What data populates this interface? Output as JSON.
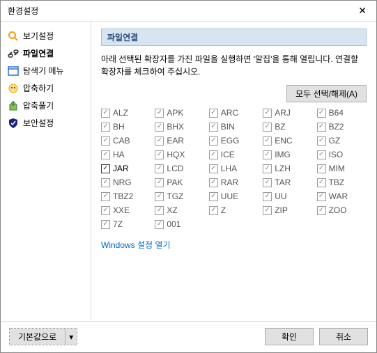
{
  "window": {
    "title": "환경설정",
    "close_glyph": "✕"
  },
  "sidebar": {
    "items": [
      {
        "label": "보기설정"
      },
      {
        "label": "파일연결"
      },
      {
        "label": "탐색기 메뉴"
      },
      {
        "label": "압축하기"
      },
      {
        "label": "압축풀기"
      },
      {
        "label": "보안설정"
      }
    ],
    "active_index": 1
  },
  "main": {
    "section_title": "파일연결",
    "description": "아래 선택된 확장자를 가진 파일을 실행하면 '알집'을 통해 열립니다. 연결할 확장자를 체크하여 주십시오.",
    "select_all_label": "모두 선택/해제(A)",
    "extensions": [
      {
        "name": "ALZ",
        "checked": true,
        "enabled": false
      },
      {
        "name": "APK",
        "checked": true,
        "enabled": false
      },
      {
        "name": "ARC",
        "checked": true,
        "enabled": false
      },
      {
        "name": "ARJ",
        "checked": true,
        "enabled": false
      },
      {
        "name": "B64",
        "checked": true,
        "enabled": false
      },
      {
        "name": "BH",
        "checked": true,
        "enabled": false
      },
      {
        "name": "BHX",
        "checked": true,
        "enabled": false
      },
      {
        "name": "BIN",
        "checked": true,
        "enabled": false
      },
      {
        "name": "BZ",
        "checked": true,
        "enabled": false
      },
      {
        "name": "BZ2",
        "checked": true,
        "enabled": false
      },
      {
        "name": "CAB",
        "checked": true,
        "enabled": false
      },
      {
        "name": "EAR",
        "checked": true,
        "enabled": false
      },
      {
        "name": "EGG",
        "checked": true,
        "enabled": false
      },
      {
        "name": "ENC",
        "checked": true,
        "enabled": false
      },
      {
        "name": "GZ",
        "checked": true,
        "enabled": false
      },
      {
        "name": "HA",
        "checked": true,
        "enabled": false
      },
      {
        "name": "HQX",
        "checked": true,
        "enabled": false
      },
      {
        "name": "ICE",
        "checked": true,
        "enabled": false
      },
      {
        "name": "IMG",
        "checked": true,
        "enabled": false
      },
      {
        "name": "ISO",
        "checked": true,
        "enabled": false
      },
      {
        "name": "JAR",
        "checked": true,
        "enabled": true
      },
      {
        "name": "LCD",
        "checked": true,
        "enabled": false
      },
      {
        "name": "LHA",
        "checked": true,
        "enabled": false
      },
      {
        "name": "LZH",
        "checked": true,
        "enabled": false
      },
      {
        "name": "MIM",
        "checked": true,
        "enabled": false
      },
      {
        "name": "NRG",
        "checked": true,
        "enabled": false
      },
      {
        "name": "PAK",
        "checked": true,
        "enabled": false
      },
      {
        "name": "RAR",
        "checked": true,
        "enabled": false
      },
      {
        "name": "TAR",
        "checked": true,
        "enabled": false
      },
      {
        "name": "TBZ",
        "checked": true,
        "enabled": false
      },
      {
        "name": "TBZ2",
        "checked": true,
        "enabled": false
      },
      {
        "name": "TGZ",
        "checked": true,
        "enabled": false
      },
      {
        "name": "UUE",
        "checked": true,
        "enabled": false
      },
      {
        "name": "UU",
        "checked": true,
        "enabled": false
      },
      {
        "name": "WAR",
        "checked": true,
        "enabled": false
      },
      {
        "name": "XXE",
        "checked": true,
        "enabled": false
      },
      {
        "name": "XZ",
        "checked": true,
        "enabled": false
      },
      {
        "name": "Z",
        "checked": true,
        "enabled": false
      },
      {
        "name": "ZIP",
        "checked": true,
        "enabled": false
      },
      {
        "name": "ZOO",
        "checked": true,
        "enabled": false
      },
      {
        "name": "7Z",
        "checked": true,
        "enabled": false
      },
      {
        "name": "001",
        "checked": true,
        "enabled": false
      }
    ],
    "link_label": "Windows 설정 열기"
  },
  "footer": {
    "defaults_label": "기본값으로",
    "caret": "▾",
    "ok_label": "확인",
    "cancel_label": "취소"
  },
  "icons": {
    "view": "#f39c12",
    "file": "#555",
    "explorer": "#2e6bd6",
    "compress": "#f1c40f",
    "extract": "#2e7d32",
    "security": "#1a237e"
  }
}
